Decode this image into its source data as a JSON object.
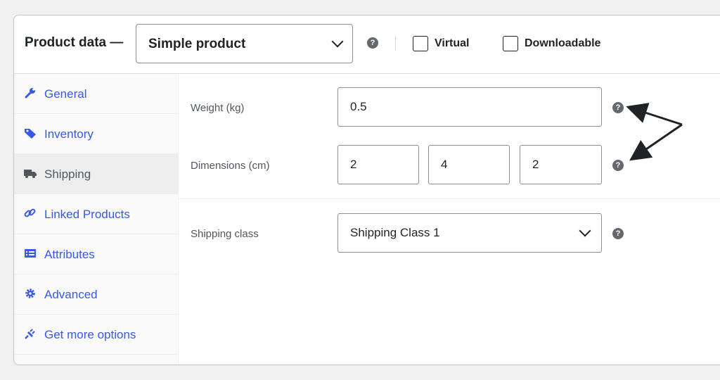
{
  "header": {
    "title": "Product data —",
    "product_type": "Simple product",
    "help_icon": "question-circle-icon",
    "virtual_label": "Virtual",
    "virtual_checked": false,
    "downloadable_label": "Downloadable",
    "downloadable_checked": false
  },
  "sidebar": {
    "active": "Shipping",
    "items": [
      {
        "label": "General",
        "icon": "wrench-icon"
      },
      {
        "label": "Inventory",
        "icon": "tag-icon"
      },
      {
        "label": "Shipping",
        "icon": "truck-icon"
      },
      {
        "label": "Linked Products",
        "icon": "link-icon"
      },
      {
        "label": "Attributes",
        "icon": "list-icon"
      },
      {
        "label": "Advanced",
        "icon": "gear-icon"
      },
      {
        "label": "Get more options",
        "icon": "plug-icon"
      }
    ]
  },
  "shipping": {
    "weight_label": "Weight (kg)",
    "weight_value": "0.5",
    "dimensions_label": "Dimensions (cm)",
    "length_value": "2",
    "width_value": "4",
    "height_value": "2",
    "class_label": "Shipping class",
    "class_value": "Shipping Class 1"
  },
  "colors": {
    "link": "#3858e9",
    "active_tab_bg": "#eeeeee",
    "help_icon": "#646970"
  }
}
